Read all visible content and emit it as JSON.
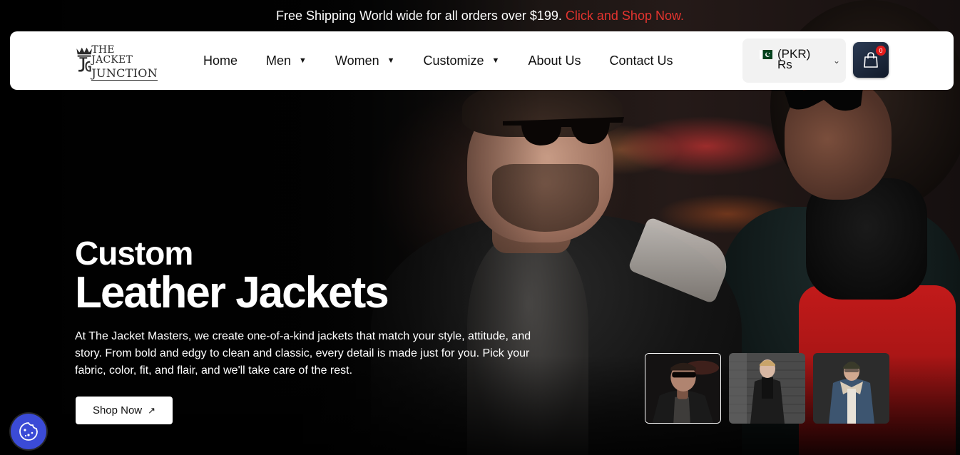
{
  "announcement": {
    "text": "Free Shipping World wide for all orders over $199.",
    "link": "Click and Shop Now."
  },
  "brand": {
    "line1": "THE JACKET",
    "line2": "JUNCTION"
  },
  "nav": {
    "home": "Home",
    "men": "Men",
    "women": "Women",
    "customize": "Customize",
    "about": "About Us",
    "contact": "Contact Us"
  },
  "currency": {
    "label": "(PKR) Rs",
    "flag": "pakistan-flag-icon"
  },
  "cart": {
    "count": "0"
  },
  "hero": {
    "title_line1": "Custom",
    "title_line2": "Leather Jackets",
    "description": "At The Jacket Masters, we create one-of-a-kind jackets that match your style, attitude, and story. From bold and edgy to clean and classic, every detail is made just for you. Pick your fabric, color, fit, and flair, and we'll take care of the rest.",
    "cta": "Shop Now",
    "cta_icon": "arrow-up-right-icon"
  },
  "thumbnails": {
    "active_index": 0,
    "items": [
      "man-leather-jacket-thumbnail",
      "man-black-coat-thumbnail",
      "man-denim-jacket-thumbnail"
    ]
  },
  "colors": {
    "accent_red": "#e3342f",
    "cart_bg": "#1b2638",
    "cookie_bg": "#3b4bd6",
    "header_bg": "#ffffff"
  }
}
